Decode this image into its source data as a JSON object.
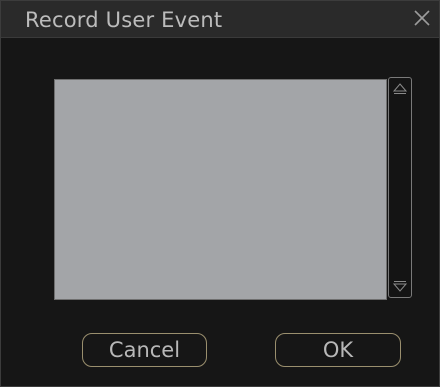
{
  "dialog": {
    "title": "Record User Event",
    "close_icon": "close-icon",
    "colors": {
      "list_background": "#a3a5a8",
      "button_border": "#9a8f6e"
    }
  },
  "scrollbar": {
    "up_icon": "scroll-up-arrow-icon",
    "down_icon": "scroll-down-arrow-icon"
  },
  "buttons": {
    "cancel": "Cancel",
    "ok": "OK"
  }
}
